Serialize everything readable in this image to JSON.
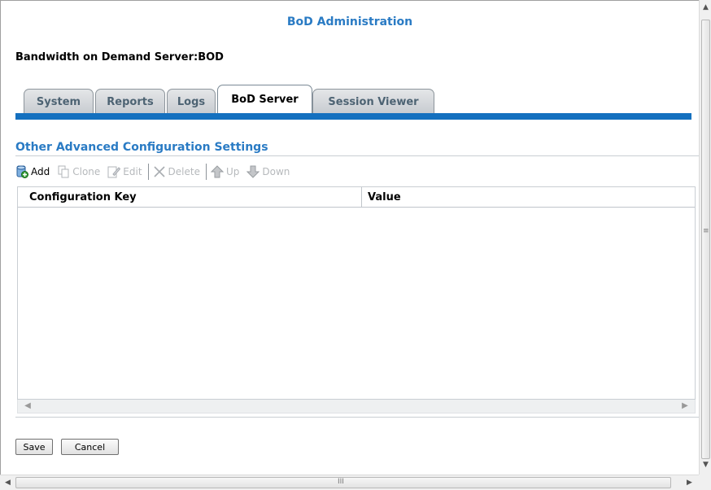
{
  "page": {
    "title": "BoD Administration",
    "server_label": "Bandwidth on Demand Server:BOD"
  },
  "tabs": [
    {
      "label": "System",
      "active": false
    },
    {
      "label": "Reports",
      "active": false
    },
    {
      "label": "Logs",
      "active": false
    },
    {
      "label": "BoD Server",
      "active": true
    },
    {
      "label": "Session Viewer",
      "active": false
    }
  ],
  "section": {
    "title": "Other Advanced Configuration Settings"
  },
  "toolbar": {
    "add": "Add",
    "clone": "Clone",
    "edit": "Edit",
    "delete": "Delete",
    "up": "Up",
    "down": "Down"
  },
  "table": {
    "columns": [
      "Configuration Key",
      "Value"
    ],
    "rows": []
  },
  "footer": {
    "save": "Save",
    "cancel": "Cancel"
  },
  "scrollbar": {
    "grip": "III"
  },
  "colors": {
    "accent": "#2a7bc4",
    "tab_underline": "#1470bf"
  }
}
